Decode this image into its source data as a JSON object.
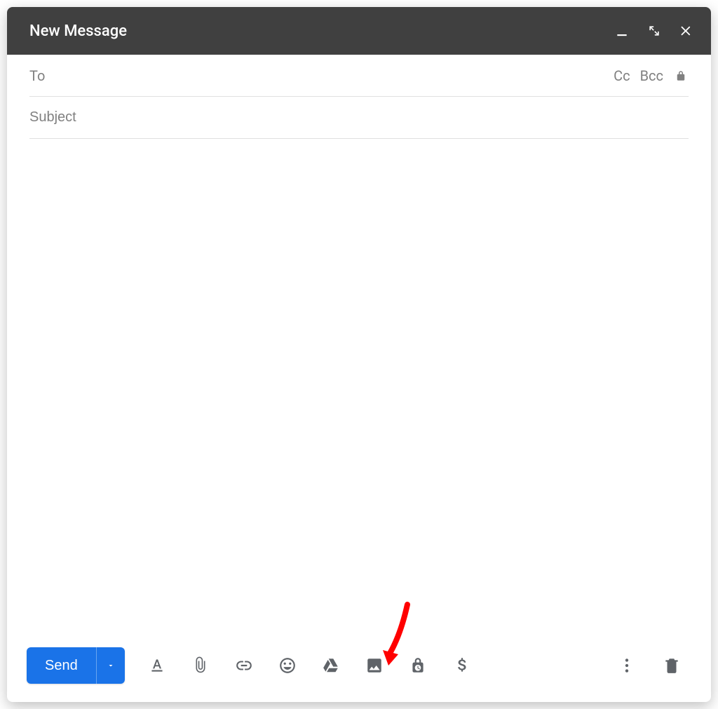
{
  "header": {
    "title": "New Message"
  },
  "fields": {
    "to_label": "To",
    "to_value": "",
    "cc_label": "Cc",
    "bcc_label": "Bcc",
    "subject_placeholder": "Subject",
    "subject_value": ""
  },
  "body": {
    "value": ""
  },
  "footer": {
    "send_label": "Send"
  }
}
